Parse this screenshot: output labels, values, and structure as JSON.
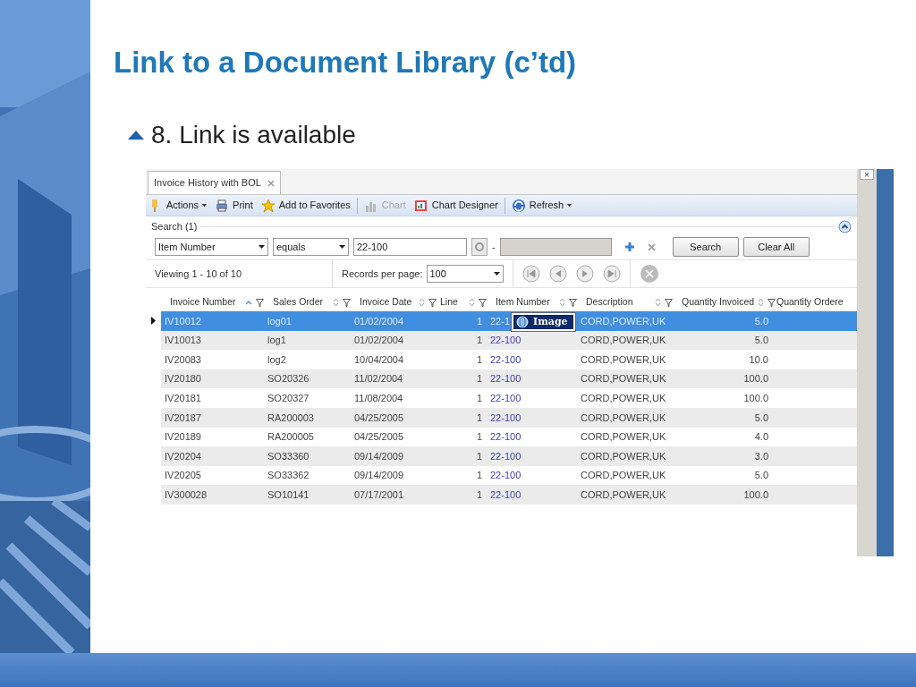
{
  "slide": {
    "title": "Link to a Document Library (c’td)",
    "bullet": "8. Link is available"
  },
  "app": {
    "tab": {
      "label": "Invoice History with BOL",
      "selected": true
    },
    "toolbar": [
      {
        "label": "Actions",
        "kind": "menu",
        "disabled": false
      },
      {
        "label": "Print",
        "kind": "button",
        "disabled": false
      },
      {
        "label": "Add to Favorites",
        "kind": "button",
        "disabled": false
      },
      {
        "kind": "separator"
      },
      {
        "label": "Chart",
        "kind": "button",
        "disabled": true
      },
      {
        "label": "Chart Designer",
        "kind": "button",
        "disabled": false
      },
      {
        "kind": "separator"
      },
      {
        "label": "Refresh",
        "kind": "menu",
        "disabled": false
      }
    ],
    "search": {
      "title": "Search (1)",
      "expanded": true,
      "field": "Item Number",
      "operator": "equals",
      "value": "22-100",
      "dash": "-",
      "buttons": [
        "Search",
        "Clear All"
      ]
    },
    "paging": {
      "viewing": "Viewing 1 - 10  of 10",
      "per_page_label": "Records per page:",
      "per_page": "100"
    },
    "columns": [
      {
        "label": "Invoice Number",
        "sorted_ascending": true
      },
      {
        "label": "Sales Order",
        "sorted_ascending": false
      },
      {
        "label": "Invoice Date",
        "sorted_ascending": false
      },
      {
        "label": "Line",
        "sorted_ascending": false
      },
      {
        "label": "Item Number",
        "sorted_ascending": false
      },
      {
        "label": "Description",
        "sorted_ascending": false
      },
      {
        "label": "Quantity Invoiced",
        "sorted_ascending": false
      },
      {
        "label": "Quantity Ordere"
      }
    ],
    "rows": [
      {
        "selected": true,
        "cells": [
          "IV10012",
          "log01",
          "01/02/2004",
          "1",
          "22-1",
          "CORD,POWER,UK",
          "5.0"
        ]
      },
      {
        "selected": false,
        "cells": [
          "IV10013",
          "log1",
          "01/02/2004",
          "1",
          "22-100",
          "CORD,POWER,UK",
          "5.0"
        ]
      },
      {
        "selected": false,
        "cells": [
          "IV20083",
          "log2",
          "10/04/2004",
          "1",
          "22-100",
          "CORD,POWER,UK",
          "10.0"
        ]
      },
      {
        "selected": false,
        "cells": [
          "IV20180",
          "SO20326",
          "11/02/2004",
          "1",
          "22-100",
          "CORD,POWER,UK",
          "100.0"
        ]
      },
      {
        "selected": false,
        "cells": [
          "IV20181",
          "SO20327",
          "11/08/2004",
          "1",
          "22-100",
          "CORD,POWER,UK",
          "100.0"
        ]
      },
      {
        "selected": false,
        "cells": [
          "IV20187",
          "RA200003",
          "04/25/2005",
          "1",
          "22-100",
          "CORD,POWER,UK",
          "5.0"
        ]
      },
      {
        "selected": false,
        "cells": [
          "IV20189",
          "RA200005",
          "04/25/2005",
          "1",
          "22-100",
          "CORD,POWER,UK",
          "4.0"
        ]
      },
      {
        "selected": false,
        "cells": [
          "IV20204",
          "SO33360",
          "09/14/2009",
          "1",
          "22-100",
          "CORD,POWER,UK",
          "3.0"
        ]
      },
      {
        "selected": false,
        "cells": [
          "IV20205",
          "SO33362",
          "09/14/2009",
          "1",
          "22-100",
          "CORD,POWER,UK",
          "5.0"
        ]
      },
      {
        "selected": false,
        "cells": [
          "IV300028",
          "SO10141",
          "07/17/2001",
          "1",
          "22-100",
          "CORD,POWER,UK",
          "100.0"
        ]
      }
    ],
    "tooltip": {
      "label": "Image"
    },
    "window_close": "×"
  }
}
